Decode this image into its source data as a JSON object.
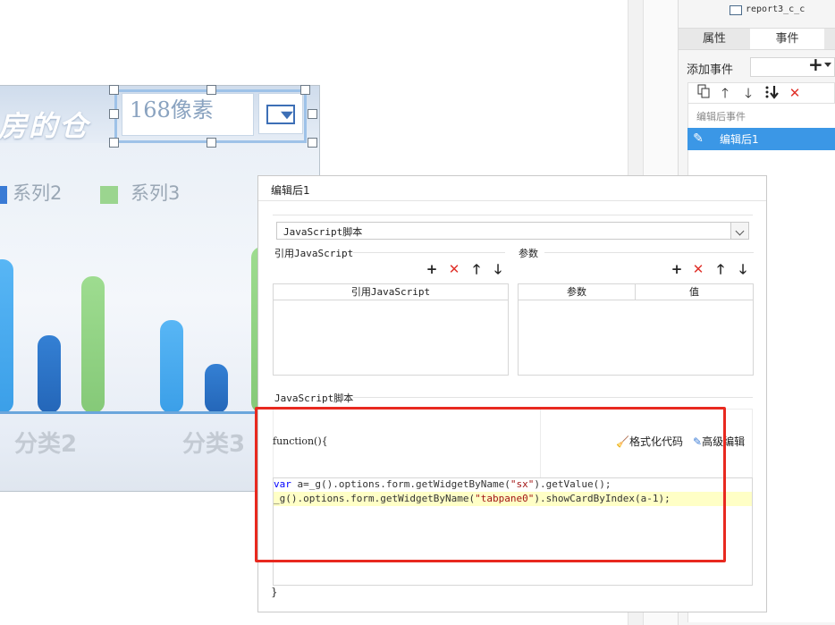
{
  "chart": {
    "title_fragment": "房的仓",
    "legend": [
      {
        "label": "系列2",
        "color": "#3a7bd5"
      },
      {
        "label": "系列3",
        "color": "#9bd58f"
      }
    ],
    "categories": [
      "分类2",
      "分类3"
    ],
    "colors": {
      "series1": "#5ab3f3",
      "series2": "#2f73c4",
      "series3": "#93d488"
    }
  },
  "combo": {
    "text": "168像素"
  },
  "right_panel": {
    "report_item": "report3_c_c",
    "tabs": [
      "属性",
      "事件"
    ],
    "add_event_label": "添加事件",
    "event_group_label": "编辑后事件",
    "event_item_label": "编辑后1"
  },
  "dialog": {
    "title": "编辑后1",
    "script_type": "JavaScript脚本",
    "ref_js_label": "引用JavaScript",
    "params_label": "参数",
    "ref_js_column": "引用JavaScript",
    "params_columns": [
      "参数",
      "值"
    ],
    "js_section_label": "JavaScript脚本",
    "function_header": "function(){",
    "format_code_label": "格式化代码",
    "advanced_edit_label": "高级编辑",
    "code_lines": [
      "var a=_g().options.form.getWidgetByName(\"sx\").getValue();",
      "_g().options.form.getWidgetByName(\"tabpane0\").showCardByIndex(a-1);"
    ],
    "closing_brace": "}"
  },
  "colors": {
    "selection_blue": "#3b97e6",
    "highlight_red": "#e8291f",
    "delete_red": "#e0322b"
  },
  "icons": {
    "toolbar": [
      "copy-icon",
      "arrow-up-icon",
      "arrow-down-icon",
      "move-bottom-icon",
      "delete-icon"
    ],
    "dialog": [
      "add-icon",
      "delete-icon",
      "arrow-up-icon",
      "arrow-down-icon"
    ]
  }
}
